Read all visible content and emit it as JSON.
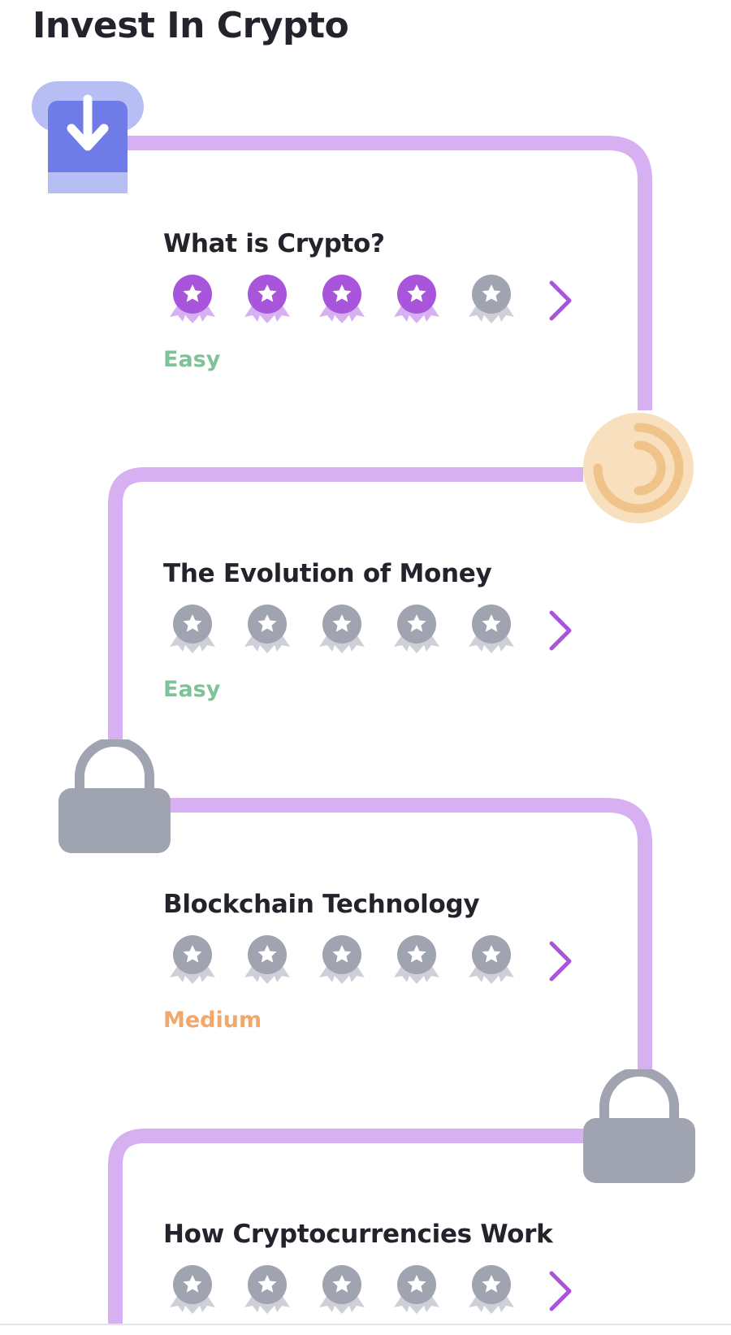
{
  "page": {
    "title": "Invest In Crypto"
  },
  "colors": {
    "path": "#d6b0f0",
    "badge_earned": "#a855dc",
    "badge_earned_ribbon": "#d6b0f0",
    "badge_locked": "#a0a3b0",
    "badge_locked_ribbon": "#cfd0d7",
    "arrow": "#a855dc",
    "easy": "#7fc29a",
    "medium": "#f2a86a",
    "lock": "#a0a3b0",
    "progress_bg": "#f8dfbd",
    "progress_ring": "#f0c38a",
    "start_dark": "#6f7be6",
    "start_light": "#b7bef3"
  },
  "nodes": [
    {
      "name": "start-node",
      "icon": "download-arrow-icon",
      "status": "completed"
    },
    {
      "name": "progress-node",
      "icon": "progress-ring-icon",
      "status": "in-progress"
    },
    {
      "name": "lock-node-1",
      "icon": "lock-icon",
      "status": "locked"
    },
    {
      "name": "lock-node-2",
      "icon": "lock-icon",
      "status": "locked"
    }
  ],
  "lessons": [
    {
      "title": "What is Crypto?",
      "difficulty": "Easy",
      "difficulty_level": "easy",
      "stars_earned": 4,
      "stars_total": 5
    },
    {
      "title": "The Evolution of Money",
      "difficulty": "Easy",
      "difficulty_level": "easy",
      "stars_earned": 0,
      "stars_total": 5
    },
    {
      "title": "Blockchain Technology",
      "difficulty": "Medium",
      "difficulty_level": "medium",
      "stars_earned": 0,
      "stars_total": 5
    },
    {
      "title": "How Cryptocurrencies Work",
      "difficulty": "",
      "difficulty_level": "",
      "stars_earned": 0,
      "stars_total": 5
    }
  ]
}
